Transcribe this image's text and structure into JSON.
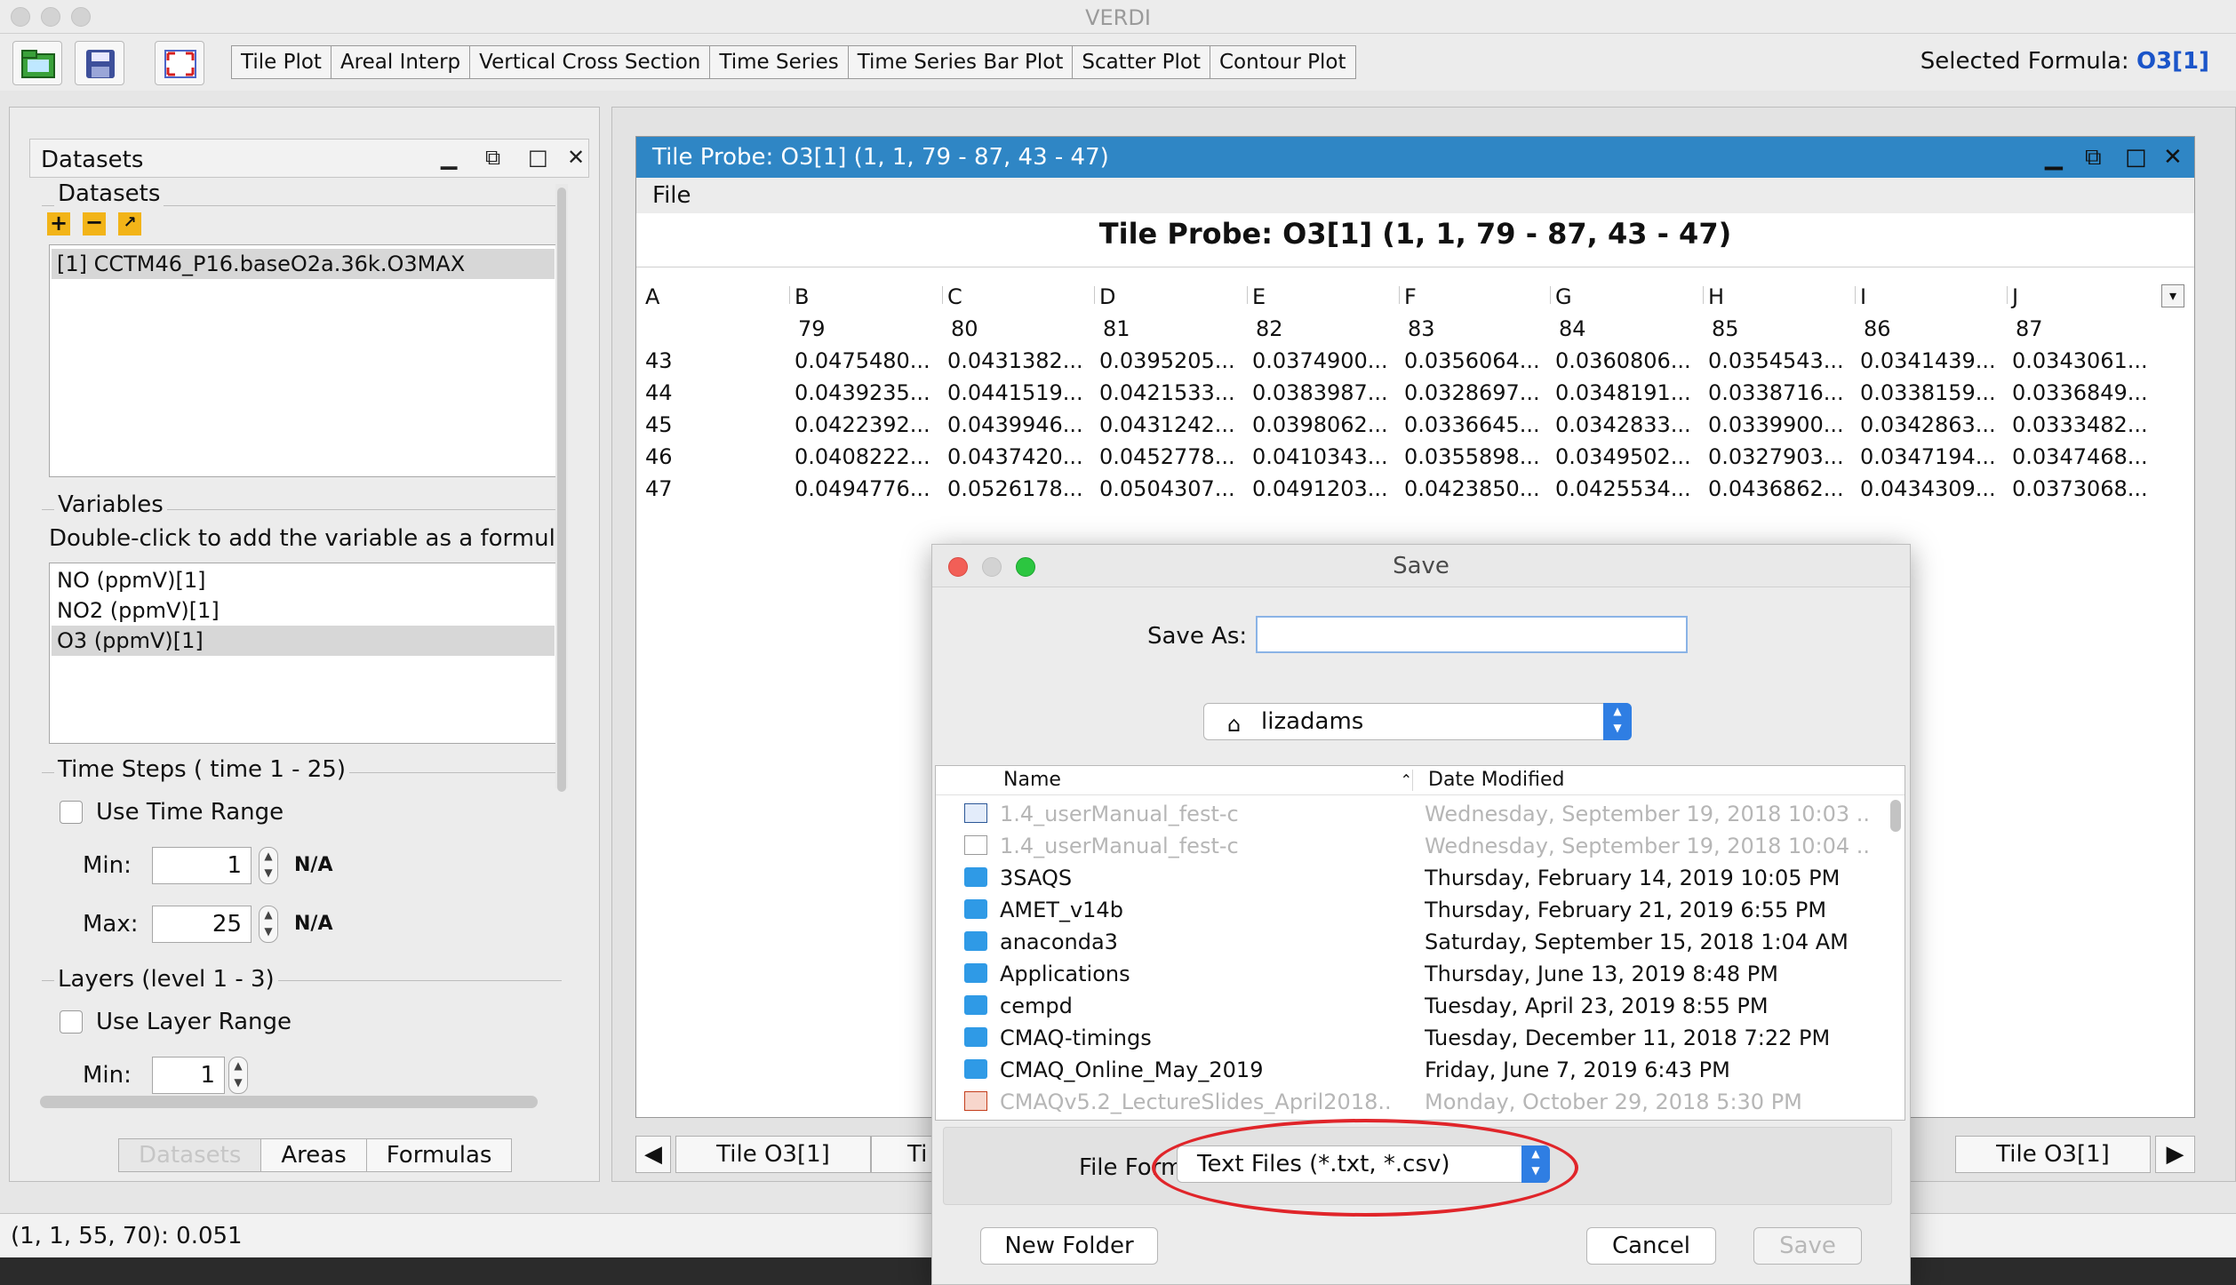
{
  "app": {
    "title": "VERDI"
  },
  "toolbar": {
    "plot_buttons": [
      "Tile Plot",
      "Areal Interp",
      "Vertical Cross Section",
      "Time Series",
      "Time Series Bar Plot",
      "Scatter Plot",
      "Contour Plot"
    ],
    "selected_formula_label": "Selected Formula:",
    "selected_formula_value": "O3[1]"
  },
  "left_panel": {
    "header": "Datasets",
    "datasets_title": "Datasets",
    "datasets": [
      "[1] CCTM46_P16.baseO2a.36k.O3MAX"
    ],
    "variables_title": "Variables",
    "variables_hint": "Double-click to add the variable as a formula",
    "variables": [
      "NO (ppmV)[1]",
      "NO2 (ppmV)[1]",
      "O3 (ppmV)[1]"
    ],
    "time_steps_title": "Time Steps ( time 1 - 25)",
    "use_time_range": "Use Time Range",
    "min_label": "Min:",
    "max_label": "Max:",
    "time_min": "1",
    "time_max": "25",
    "na": "N/A",
    "layers_title": "Layers (level 1 - 3)",
    "use_layer_range": "Use Layer Range",
    "layer_min": "1",
    "tabs": [
      "Datasets",
      "Areas",
      "Formulas"
    ]
  },
  "probe": {
    "title": "Tile Probe: O3[1]  (1, 1, 79 - 87, 43 - 47)",
    "menu_file": "File",
    "heading": "Tile Probe: O3[1]  (1, 1, 79 - 87, 43 - 47)",
    "col_letters": [
      "A",
      "B",
      "C",
      "D",
      "E",
      "F",
      "G",
      "H",
      "I",
      "J"
    ],
    "col_numbers": [
      "79",
      "80",
      "81",
      "82",
      "83",
      "84",
      "85",
      "86",
      "87"
    ],
    "rows": [
      {
        "id": "43",
        "values": [
          "0.0475480...",
          "0.0431382...",
          "0.0395205...",
          "0.0374900...",
          "0.0356064...",
          "0.0360806...",
          "0.0354543...",
          "0.0341439...",
          "0.0343061..."
        ]
      },
      {
        "id": "44",
        "values": [
          "0.0439235...",
          "0.0441519...",
          "0.0421533...",
          "0.0383987...",
          "0.0328697...",
          "0.0348191...",
          "0.0338716...",
          "0.0338159...",
          "0.0336849..."
        ]
      },
      {
        "id": "45",
        "values": [
          "0.0422392...",
          "0.0439946...",
          "0.0431242...",
          "0.0398062...",
          "0.0336645...",
          "0.0342833...",
          "0.0339900...",
          "0.0342863...",
          "0.0333482..."
        ]
      },
      {
        "id": "46",
        "values": [
          "0.0408222...",
          "0.0437420...",
          "0.0452778...",
          "0.0410343...",
          "0.0355898...",
          "0.0349502...",
          "0.0327903...",
          "0.0347194...",
          "0.0347468..."
        ]
      },
      {
        "id": "47",
        "values": [
          "0.0494776...",
          "0.0526178...",
          "0.0504307...",
          "0.0491203...",
          "0.0423850...",
          "0.0425534...",
          "0.0436862...",
          "0.0434309...",
          "0.0373068..."
        ]
      }
    ],
    "tabs": [
      "Tile O3[1]",
      "Ti",
      "Tile O3[1]"
    ]
  },
  "status": {
    "text": "(1, 1, 55, 70): 0.051"
  },
  "dialog": {
    "title": "Save",
    "save_as_label": "Save As:",
    "save_as_value": "",
    "location": "lizadams",
    "col_name": "Name",
    "col_date": "Date Modified",
    "files": [
      {
        "name": "1.4_userManual_fest-c",
        "date": "Wednesday, September 19, 2018 10:03 ...",
        "kind": "word",
        "dim": true
      },
      {
        "name": "1.4_userManual_fest-c",
        "date": "Wednesday, September 19, 2018 10:04 ...",
        "kind": "doc",
        "dim": true
      },
      {
        "name": "3SAQS",
        "date": "Thursday, February 14, 2019 10:05 PM",
        "kind": "folder",
        "dim": false
      },
      {
        "name": "AMET_v14b",
        "date": "Thursday, February 21, 2019 6:55 PM",
        "kind": "folder",
        "dim": false
      },
      {
        "name": "anaconda3",
        "date": "Saturday, September 15, 2018 1:04 AM",
        "kind": "folder",
        "dim": false
      },
      {
        "name": "Applications",
        "date": "Thursday, June 13, 2019 8:48 PM",
        "kind": "folder",
        "dim": false
      },
      {
        "name": "cempd",
        "date": "Tuesday, April 23, 2019 8:55 PM",
        "kind": "folder",
        "dim": false
      },
      {
        "name": "CMAQ-timings",
        "date": "Tuesday, December 11, 2018 7:22 PM",
        "kind": "folder",
        "dim": false
      },
      {
        "name": "CMAQ_Online_May_2019",
        "date": "Friday, June 7, 2019 6:43 PM",
        "kind": "folder",
        "dim": false
      },
      {
        "name": "CMAQv5.2_LectureSlides_April2018....",
        "date": "Monday, October 29, 2018 5:30 PM",
        "kind": "ppt",
        "dim": true
      }
    ],
    "file_format_label": "File Format:",
    "file_format_value": "Text Files (*.txt, *.csv)",
    "new_folder": "New Folder",
    "cancel": "Cancel",
    "save": "Save"
  },
  "colors": {
    "accent": "#2f86c5",
    "formula": "#1b55c9",
    "highlight_ring": "#e0252a",
    "folder": "#2f9ae6"
  }
}
